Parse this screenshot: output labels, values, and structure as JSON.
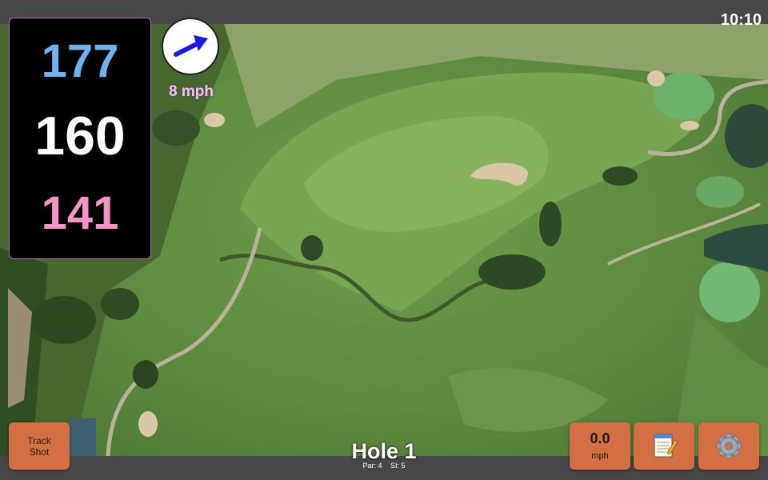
{
  "status": {
    "time": "10:10"
  },
  "distances": {
    "back": "177",
    "middle": "160",
    "front": "141"
  },
  "wind": {
    "speed_label": "8 mph",
    "direction_icon": "arrow-icon"
  },
  "track_button": {
    "label": "Track\nShot"
  },
  "speed_button": {
    "value": "0.0",
    "unit": "mph"
  },
  "notes_button": {
    "icon": "notepad-icon"
  },
  "settings_button": {
    "icon": "gear-icon"
  },
  "hole": {
    "title": "Hole 1",
    "par": "Par: 4",
    "stroke_index": "SI: 5"
  },
  "colors": {
    "back": "#6fb2ef",
    "middle": "#ffffff",
    "front": "#f493c6",
    "button": "#d46f43",
    "wind_text": "#f7c3f7"
  }
}
